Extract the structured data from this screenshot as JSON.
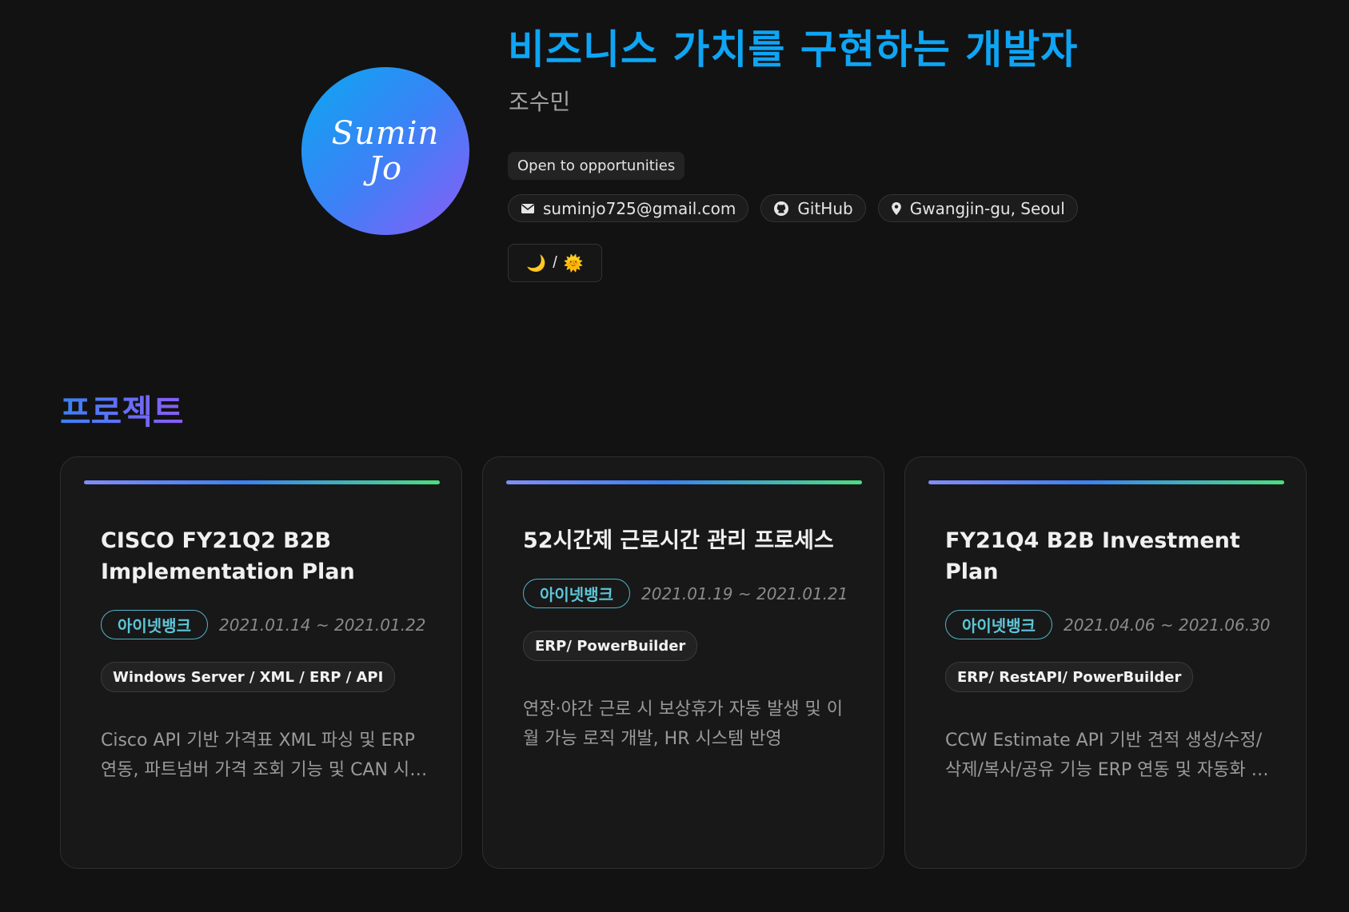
{
  "hero": {
    "title": "비즈니스 가치를 구현하는 개발자",
    "name": "조수민",
    "avatar_line1": "Sumin",
    "avatar_line2": "Jo",
    "status": "Open to opportunities",
    "contacts": [
      {
        "icon": "mail-icon",
        "label": "suminjo725@gmail.com"
      },
      {
        "icon": "github-icon",
        "label": "GitHub"
      },
      {
        "icon": "location-pin-icon",
        "label": "Gwangjin-gu, Seoul"
      }
    ],
    "theme_toggle": {
      "moon": "🌙",
      "separator": "/",
      "sun": "🌞"
    }
  },
  "projects": {
    "heading": "프로젝트",
    "cards": [
      {
        "title": "CISCO FY21Q2 B2B Implementation Plan",
        "company": "아이넷뱅크",
        "period": "2021.01.14 ~ 2021.01.22",
        "tech": "Windows Server / XML / ERP / API",
        "description": "Cisco API 기반 가격표 XML 파싱 및 ERP 연동, 파트넘버 가격 조회 기능 및 CAN 시스템 개발"
      },
      {
        "title": "52시간제 근로시간 관리 프로세스",
        "company": "아이넷뱅크",
        "period": "2021.01.19 ~ 2021.01.21",
        "tech": "ERP/ PowerBuilder",
        "description": "연장·야간 근로 시 보상휴가 자동 발생 및 이월 가능 로직 개발, HR 시스템 반영"
      },
      {
        "title": "FY21Q4 B2B Investment Plan",
        "company": "아이넷뱅크",
        "period": "2021.04.06 ~ 2021.06.30",
        "tech": "ERP/ RestAPI/ PowerBuilder",
        "description": "CCW Estimate API 기반 견적 생성/수정/삭제/복사/공유 기능 ERP 연동 및 자동화 개발"
      }
    ]
  }
}
